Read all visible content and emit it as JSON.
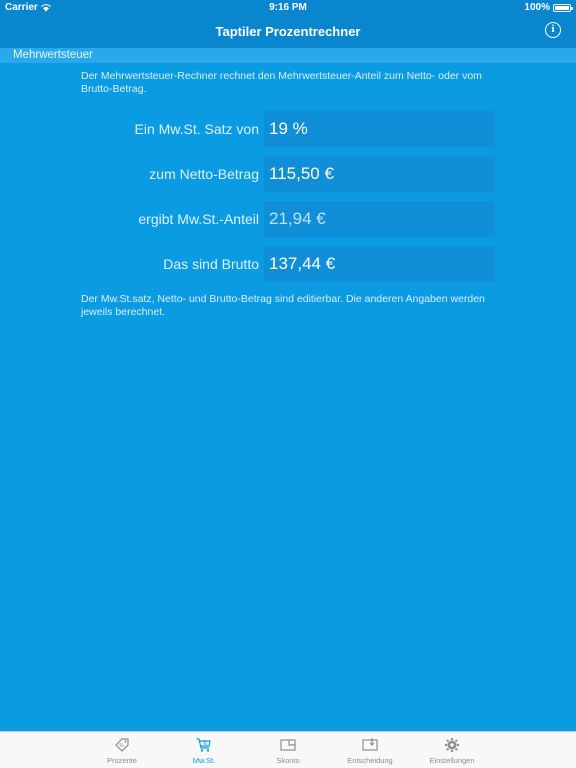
{
  "status_bar": {
    "carrier": "Carrier",
    "time": "9:16 PM",
    "battery": "100%",
    "battery_level": 1.0
  },
  "nav": {
    "title": "Taptiler Prozentrechner"
  },
  "section": {
    "title": "Mehrwertsteuer"
  },
  "intro": "Der Mehrwertsteuer-Rechner rechnet den Mehrwertsteuer-Anteil zum Netto- oder vom Brutto-Betrag.",
  "rows": [
    {
      "label": "Ein Mw.St. Satz von",
      "value": "19 %",
      "editable": true
    },
    {
      "label": "zum Netto-Betrag",
      "value": "115,50 €",
      "editable": true
    },
    {
      "label": "ergibt Mw.St.-Anteil",
      "value": "21,94 €",
      "editable": false
    },
    {
      "label": "Das sind Brutto",
      "value": "137,44 €",
      "editable": true
    }
  ],
  "note": "Der Mw.St.satz, Netto- und Brutto-Betrag sind editierbar. Die anderen Angaben werden jeweils berechnet.",
  "tabs": [
    {
      "label": "Prozente",
      "icon": "percent-tag-icon",
      "active": false
    },
    {
      "label": "Mw.St.",
      "icon": "cart-percent-icon",
      "active": true
    },
    {
      "label": "Skonto",
      "icon": "skonto-icon",
      "active": false
    },
    {
      "label": "Entscheidung",
      "icon": "decision-icon",
      "active": false
    },
    {
      "label": "Einstellungen",
      "icon": "gear-icon",
      "active": false
    }
  ],
  "colors": {
    "background": "#0a9be3",
    "nav": "#0a86cf",
    "field": "#118ed8",
    "tab_active": "#0a9be3",
    "tab_inactive": "#8e8e93"
  }
}
